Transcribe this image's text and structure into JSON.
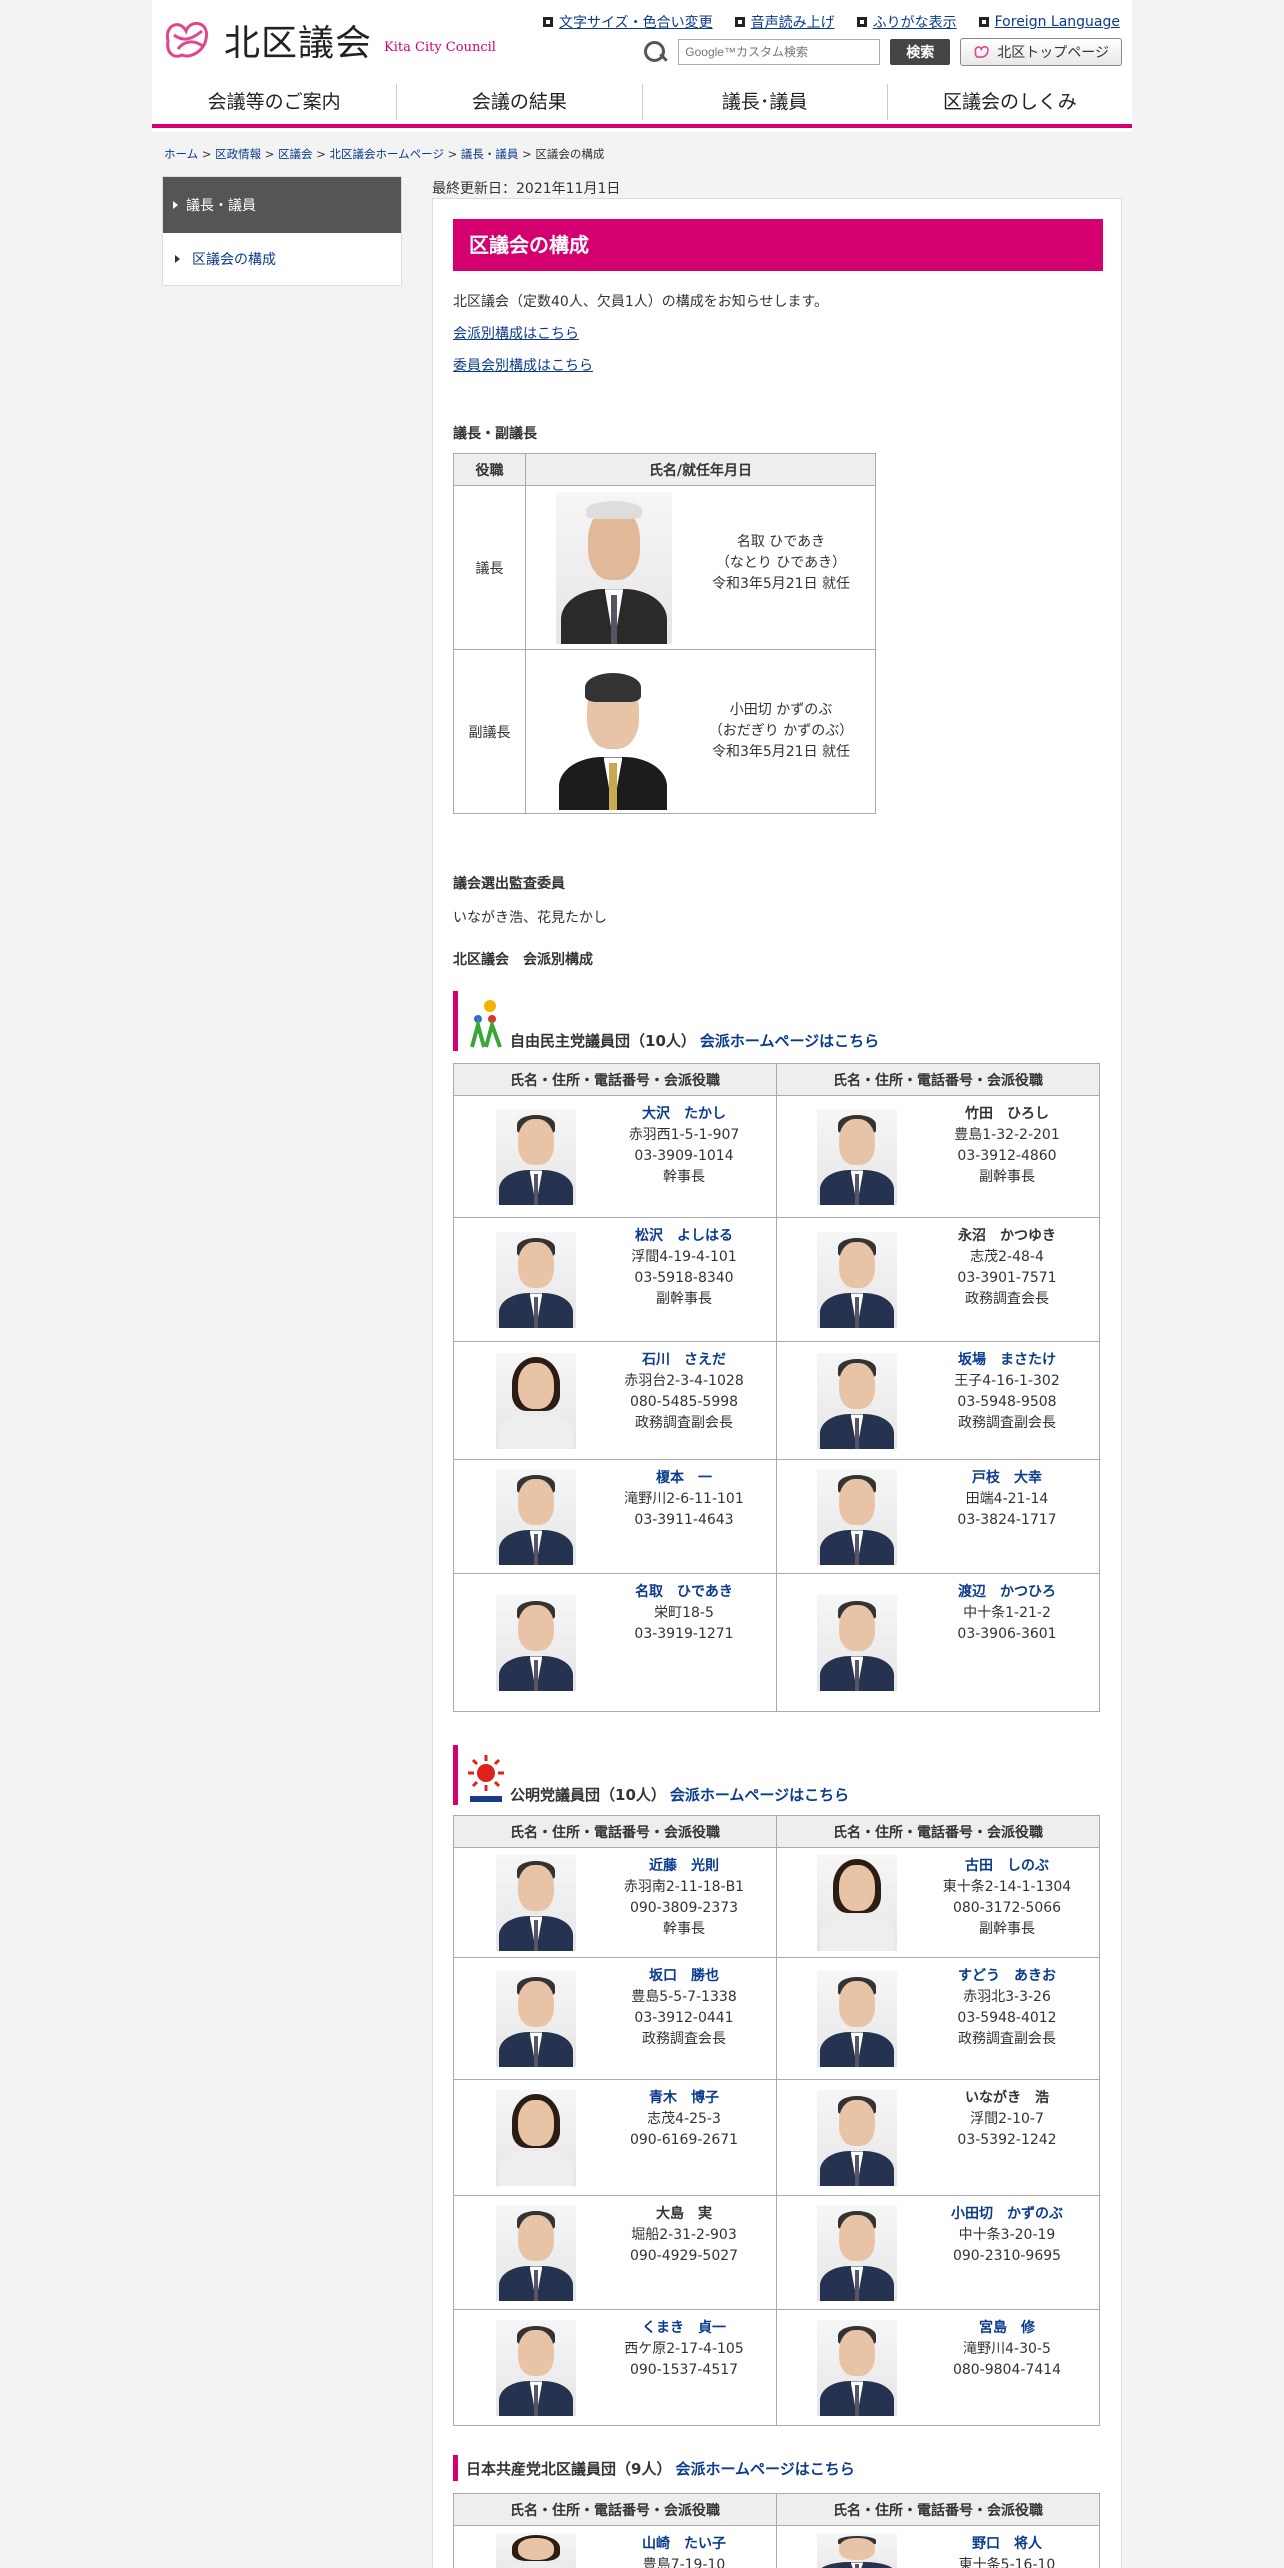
{
  "header": {
    "logo_name": "北区議会",
    "logo_en": "Kita City Council",
    "util_links": [
      "文字サイズ・色合い変更",
      "音声読み上げ",
      "ふりがな表示",
      "Foreign Language"
    ],
    "search_placeholder": "Google™カスタム検索",
    "search_button": "検索",
    "top_button": "北区トップページ",
    "nav": [
      "会議等のご案内",
      "会議の結果",
      "議長･議員",
      "区議会のしくみ"
    ],
    "brand_color": "#d5006f"
  },
  "breadcrumb": [
    "ホーム",
    "区政情報",
    "区議会",
    "北区議会ホームページ",
    "議長・議員",
    "区議会の構成"
  ],
  "sidebar": {
    "items": [
      {
        "label": "議長・議員",
        "active": true
      },
      {
        "label": "区議会の構成",
        "active": false
      }
    ]
  },
  "updated": "最終更新日：2021年11月1日",
  "main": {
    "title": "区議会の構成",
    "intro": "北区議会（定数40人、欠員1人）の構成をお知らせします。",
    "link1": "会派別構成はこちら",
    "link2": "委員会別構成はこちら",
    "chair_heading": "議長・副議長",
    "chair_headers": [
      "役職",
      "氏名/就任年月日"
    ],
    "chairs": [
      {
        "role": "議長",
        "name": "名取 ひであき",
        "kana": "（なとり ひであき）",
        "date": "令和3年5月21日 就任"
      },
      {
        "role": "副議長",
        "name": "小田切 かずのぶ",
        "kana": "（おだぎり かずのぶ）",
        "date": "令和3年5月21日 就任"
      }
    ],
    "audit_heading": "議会選出監査委員",
    "audit_names": "いながき浩、花見たかし",
    "faction_heading": "北区議会　会派別構成",
    "member_header": "氏名・住所・電話番号・会派役職"
  },
  "parties": [
    {
      "name": "自由民主党議員団（10人）",
      "link": "会派ホームページはこちら",
      "members": [
        {
          "name": "大沢　たかし",
          "addr": "赤羽西1-5-1-907",
          "tel": "03-3909-1014",
          "role": "幹事長",
          "link": true
        },
        {
          "name": "竹田　ひろし",
          "addr": "豊島1-32-2-201",
          "tel": "03-3912-4860",
          "role": "副幹事長",
          "link": false
        },
        {
          "name": "松沢　よしはる",
          "addr": "浮間4-19-4-101",
          "tel": "03-5918-8340",
          "role": "副幹事長",
          "link": true
        },
        {
          "name": "永沼　かつゆき",
          "addr": "志茂2-48-4",
          "tel": "03-3901-7571",
          "role": "政務調査会長",
          "link": false
        },
        {
          "name": "石川　さえだ",
          "addr": "赤羽台2-3-4-1028",
          "tel": "080-5485-5998",
          "role": "政務調査副会長",
          "link": true
        },
        {
          "name": "坂場　まさたけ",
          "addr": "王子4-16-1-302",
          "tel": "03-5948-9508",
          "role": "政務調査副会長",
          "link": true
        },
        {
          "name": "榎本　一",
          "addr": "滝野川2-6-11-101",
          "tel": "03-3911-4643",
          "role": "",
          "link": true
        },
        {
          "name": "戸枝　大幸",
          "addr": "田端4-21-14",
          "tel": "03-3824-1717",
          "role": "",
          "link": true
        },
        {
          "name": "名取　ひであき",
          "addr": "栄町18-5",
          "tel": "03-3919-1271",
          "role": "",
          "link": true
        },
        {
          "name": "渡辺　かつひろ",
          "addr": "中十条1-21-2",
          "tel": "03-3906-3601",
          "role": "",
          "link": true
        }
      ]
    },
    {
      "name": "公明党議員団（10人）",
      "link": "会派ホームページはこちら",
      "members": [
        {
          "name": "近藤　光則",
          "addr": "赤羽南2-11-18-B1",
          "tel": "090-3809-2373",
          "role": "幹事長",
          "link": true
        },
        {
          "name": "古田　しのぶ",
          "addr": "東十条2-14-1-1304",
          "tel": "080-3172-5066",
          "role": "副幹事長",
          "link": true
        },
        {
          "name": "坂口　勝也",
          "addr": "豊島5-5-7-1338",
          "tel": "03-3912-0441",
          "role": "政務調査会長",
          "link": true
        },
        {
          "name": "すどう　あきお",
          "addr": "赤羽北3-3-26",
          "tel": "03-5948-4012",
          "role": "政務調査副会長",
          "link": true
        },
        {
          "name": "青木　博子",
          "addr": "志茂4-25-3",
          "tel": "090-6169-2671",
          "role": "",
          "link": true
        },
        {
          "name": "いながき　浩",
          "addr": "浮間2-10-7",
          "tel": "03-5392-1242",
          "role": "",
          "link": false
        },
        {
          "name": "大島　実",
          "addr": "堀船2-31-2-903",
          "tel": "090-4929-5027",
          "role": "",
          "link": false
        },
        {
          "name": "小田切　かずのぶ",
          "addr": "中十条3-20-19",
          "tel": "090-2310-9695",
          "role": "",
          "link": true
        },
        {
          "name": "くまき　貞一",
          "addr": "西ケ原2-17-4-105",
          "tel": "090-1537-4517",
          "role": "",
          "link": true
        },
        {
          "name": "宮島　修",
          "addr": "滝野川4-30-5",
          "tel": "080-9804-7414",
          "role": "",
          "link": true
        }
      ]
    },
    {
      "name": "日本共産党北区議員団（9人）",
      "link": "会派ホームページはこちら",
      "members": [
        {
          "name": "山崎　たい子",
          "addr": "豊島7-19-10",
          "tel": "",
          "role": "",
          "link": true
        },
        {
          "name": "野口　将人",
          "addr": "東十条5-16-10",
          "tel": "",
          "role": "",
          "link": true
        }
      ]
    }
  ]
}
